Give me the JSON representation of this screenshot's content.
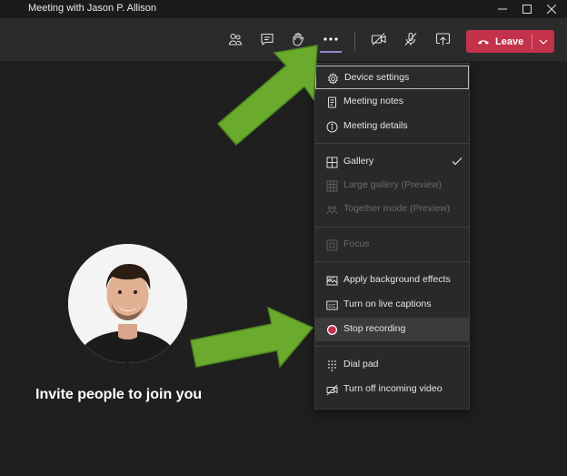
{
  "window": {
    "title": "Meeting with Jason P. Allison",
    "controls": [
      "minimize-icon",
      "maximize-icon",
      "close-icon"
    ]
  },
  "toolbar": {
    "icons": [
      "participants-icon",
      "chat-icon",
      "raise-hand-icon",
      "more-actions-icon",
      "camera-off-icon",
      "mic-off-icon",
      "share-screen-icon"
    ],
    "leave_label": "Leave"
  },
  "menu": {
    "groups": [
      [
        {
          "label": "Device settings",
          "icon": "gear-icon",
          "state": "focused"
        },
        {
          "label": "Meeting notes",
          "icon": "notes-icon",
          "state": "enabled"
        },
        {
          "label": "Meeting details",
          "icon": "info-icon",
          "state": "enabled"
        }
      ],
      [
        {
          "label": "Gallery",
          "icon": "gallery-grid-icon",
          "state": "checked"
        },
        {
          "label": "Large gallery (Preview)",
          "icon": "large-gallery-icon",
          "state": "disabled"
        },
        {
          "label": "Together mode (Preview)",
          "icon": "together-mode-icon",
          "state": "disabled"
        }
      ],
      [
        {
          "label": "Focus",
          "icon": "focus-icon",
          "state": "disabled"
        }
      ],
      [
        {
          "label": "Apply background effects",
          "icon": "background-effects-icon",
          "state": "enabled"
        },
        {
          "label": "Turn on live captions",
          "icon": "captions-icon",
          "state": "enabled"
        },
        {
          "label": "Stop recording",
          "icon": "recording-icon",
          "state": "hovered"
        }
      ],
      [
        {
          "label": "Dial pad",
          "icon": "dial-pad-icon",
          "state": "enabled"
        },
        {
          "label": "Turn off incoming video",
          "icon": "video-off-icon",
          "state": "enabled"
        }
      ]
    ]
  },
  "stage": {
    "invite_text": "Invite people to join you"
  },
  "colors": {
    "leave_red": "#c4314b",
    "arrow_green": "#6aab2e",
    "recording_red": "#c4314b",
    "accent_purple": "#8b8cc7"
  }
}
